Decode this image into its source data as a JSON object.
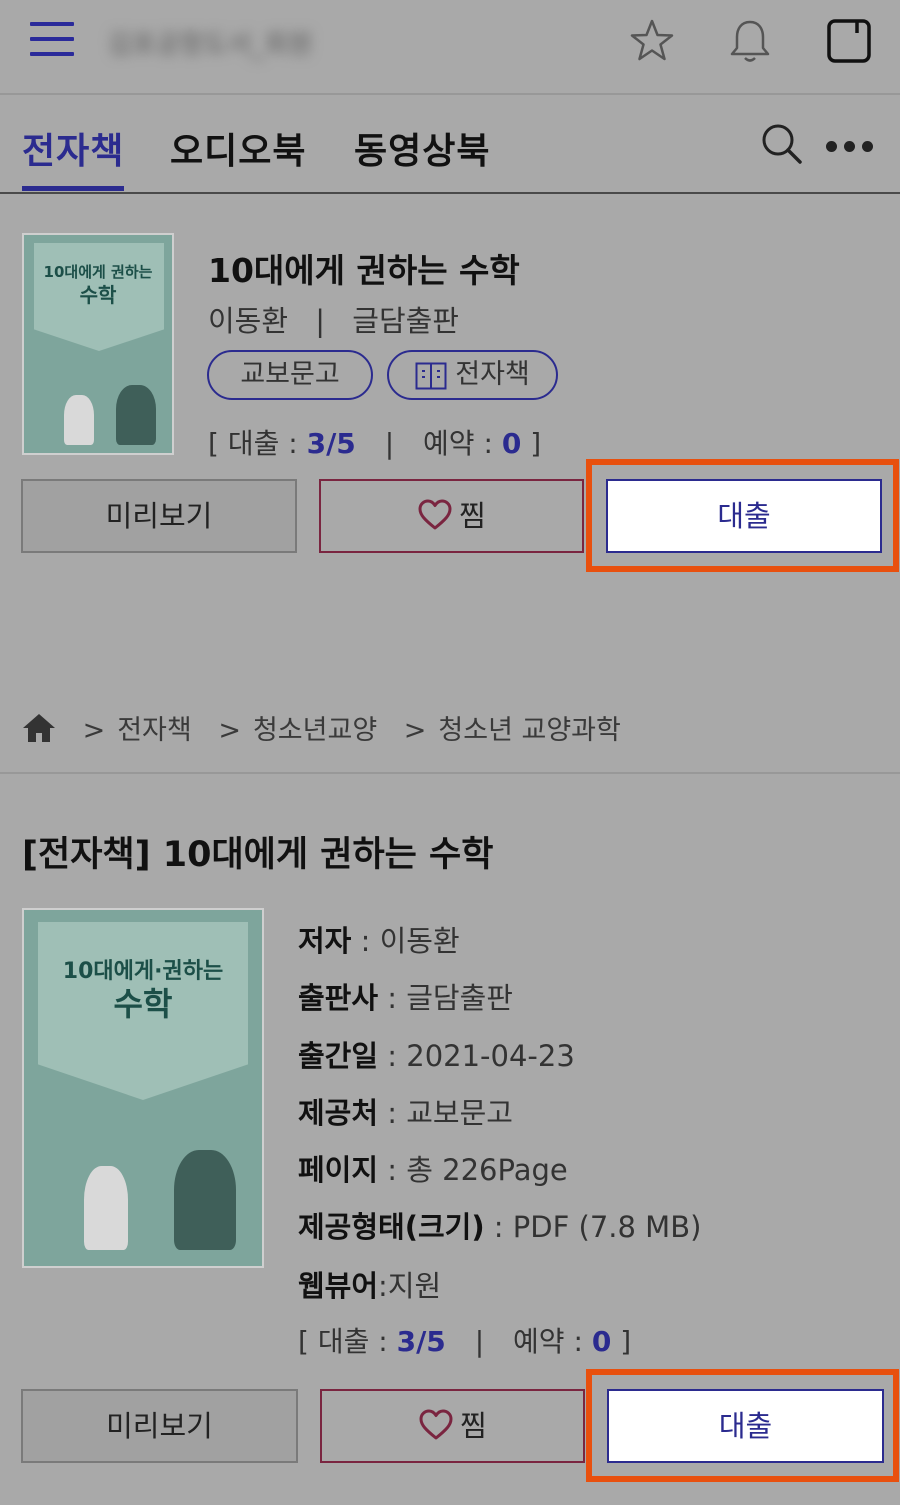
{
  "header": {
    "title_blurred": "김포공항도서_회원",
    "icons": [
      "hamburger-menu-icon",
      "star-icon",
      "bell-icon",
      "panel-icon"
    ]
  },
  "tabs": [
    {
      "label": "전자책",
      "active": true
    },
    {
      "label": "오디오북",
      "active": false
    },
    {
      "label": "동영상북",
      "active": false
    }
  ],
  "list_item": {
    "title": "10대에게 권하는 수학",
    "author": "이동환",
    "publisher": "글담출판",
    "author_publisher_sep": "|",
    "tags": [
      "교보문고",
      "전자책"
    ],
    "loan_label": "[ 대출 : ",
    "loan_count": "3/5",
    "reserve_label": "예약 : ",
    "reserve_count": "0",
    "close_bracket": " ]",
    "count_sep": "|",
    "buttons": {
      "preview": "미리보기",
      "wish": "찜",
      "loan": "대출"
    }
  },
  "breadcrumb": {
    "items": [
      "전자책",
      "청소년교양",
      "청소년 교양과학"
    ],
    "separator": ">"
  },
  "detail": {
    "title": "[전자책] 10대에게 권하는 수학",
    "rows": [
      {
        "label": "저자",
        "value": " : 이동환"
      },
      {
        "label": "출판사",
        "value": " : 글담출판"
      },
      {
        "label": "출간일",
        "value": " : 2021-04-23"
      },
      {
        "label": "제공처",
        "value": " : 교보문고"
      },
      {
        "label": "페이지",
        "value": " : 총 226Page"
      },
      {
        "label": "제공형태(크기)",
        "value": " : PDF (7.8 MB)"
      },
      {
        "label": "웹뷰어",
        "value": ":지원"
      }
    ],
    "loan_label": "[ 대출 : ",
    "loan_count": "3/5",
    "reserve_label": "예약 : ",
    "reserve_count": "0",
    "close_bracket": " ]",
    "count_sep": "|",
    "buttons": {
      "preview": "미리보기",
      "wish": "찜",
      "loan": "대출"
    }
  },
  "cover": {
    "small_lines": [
      "10대에게 권하는",
      "수학"
    ],
    "large_lines": [
      "10대에게·권하는",
      "수학"
    ]
  },
  "colors": {
    "accent": "#2b2b8f",
    "highlight": "#e8500e",
    "background": "#a9a9a9"
  }
}
